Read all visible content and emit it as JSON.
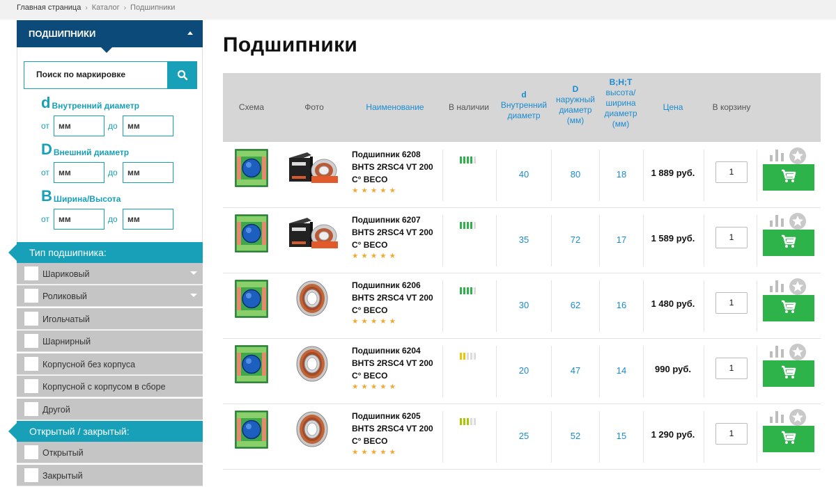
{
  "breadcrumb": {
    "home": "Главная страница",
    "catalog": "Каталог",
    "current": "Подшипники"
  },
  "sidebar": {
    "title": "ПОДШИПНИКИ",
    "search_placeholder": "Поиск по маркировке",
    "dims": [
      {
        "letter": "d",
        "label": "Внутренний диаметр"
      },
      {
        "letter": "D",
        "label": "Внешний диаметр"
      },
      {
        "letter": "B",
        "label": "Ширина/Высота"
      }
    ],
    "range": {
      "from": "от",
      "to": "до",
      "unit": "мм"
    },
    "type_section": "Тип подшипника:",
    "types": [
      "Шариковый",
      "Роликовый",
      "Игольчатый",
      "Шарнирный",
      "Корпусной без корпуса",
      "Корпусной с корпусом в сборе",
      "Другой"
    ],
    "open_section": "Открытый / закрытый:",
    "open_types": [
      "Открытый",
      "Закрытый"
    ]
  },
  "page_title": "Подшипники",
  "table": {
    "headers": {
      "schema": "Схема",
      "photo": "Фото",
      "name": "Наименование",
      "stock": "В наличии",
      "d_letter": "d",
      "d_text1": "Внутренний",
      "d_text2": "диаметр",
      "D_letter": "D",
      "D_text1": "наружный",
      "D_text2": "диаметр",
      "D_text3": "(мм)",
      "B_letter": "B;H;T",
      "B_text1": "высота/",
      "B_text2": "ширина",
      "B_text3": "диаметр",
      "B_text4": "(мм)",
      "price": "Цена",
      "cart": "В корзину"
    },
    "stars": "★★★★★",
    "rows": [
      {
        "line1": "Подшипник 6208",
        "line2": "BHTS 2RSC4 VT 200",
        "line3": "C° BECO",
        "stock_level": 4,
        "stock_color": "#2db34a",
        "d": "40",
        "D": "80",
        "B": "18",
        "price": "1 889 руб.",
        "qty": "1",
        "photo": "boxed"
      },
      {
        "line1": "Подшипник 6207",
        "line2": "BHTS 2RSC4 VT 200",
        "line3": "C° BECO",
        "stock_level": 4,
        "stock_color": "#2db34a",
        "d": "35",
        "D": "72",
        "B": "17",
        "price": "1 589 руб.",
        "qty": "1",
        "photo": "boxed"
      },
      {
        "line1": "Подшипник 6206",
        "line2": "BHTS 2RSC4 VT 200",
        "line3": "C° BECO",
        "stock_level": 4,
        "stock_color": "#2db34a",
        "d": "30",
        "D": "62",
        "B": "16",
        "price": "1 480 руб.",
        "qty": "1",
        "photo": "ring"
      },
      {
        "line1": "Подшипник 6204",
        "line2": "BHTS 2RSC4 VT 200",
        "line3": "C° BECO",
        "stock_level": 2,
        "stock_color": "#e8c800",
        "d": "20",
        "D": "47",
        "B": "14",
        "price": "990 руб.",
        "qty": "1",
        "photo": "ring"
      },
      {
        "line1": "Подшипник 6205",
        "line2": "BHTS 2RSC4 VT 200",
        "line3": "C° BECO",
        "stock_level": 3,
        "stock_color": "#a5c800",
        "d": "25",
        "D": "52",
        "B": "15",
        "price": "1 290 руб.",
        "qty": "1",
        "photo": "ring"
      }
    ]
  }
}
